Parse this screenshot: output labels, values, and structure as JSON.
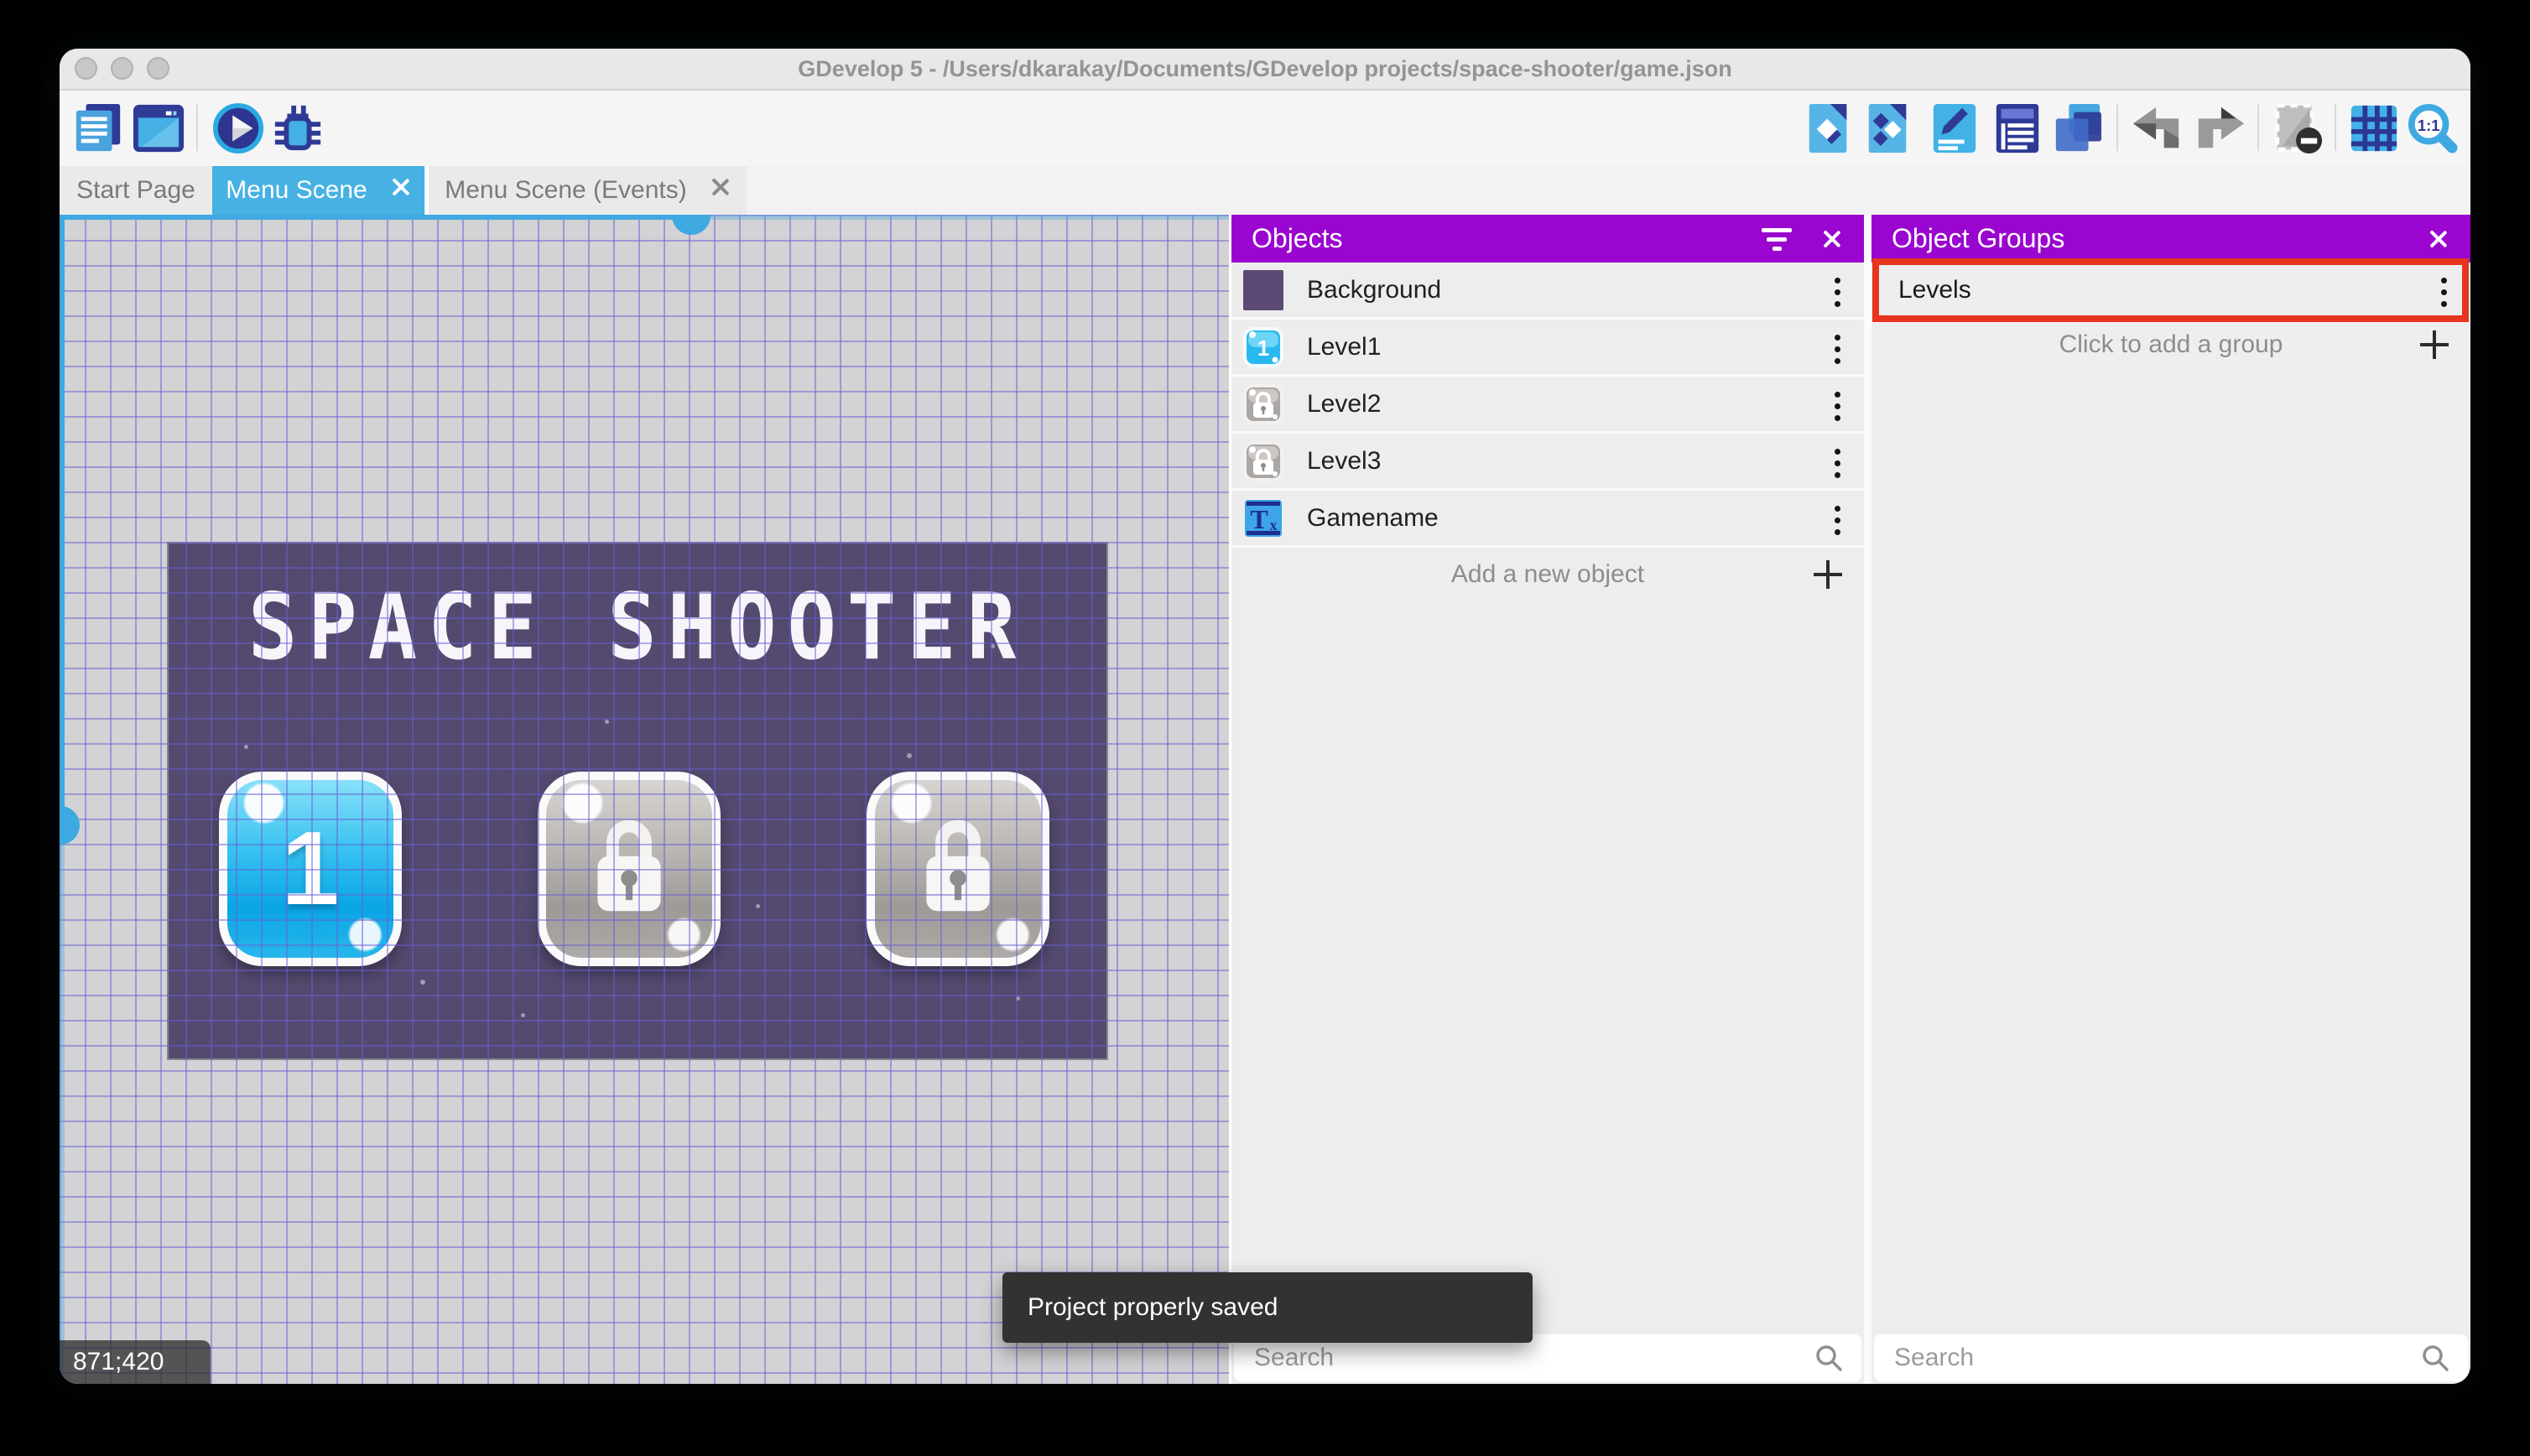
{
  "app": {
    "window_title": "GDevelop 5 - /Users/dkarakay/Documents/GDevelop projects/space-shooter/game.json"
  },
  "toolbar": {
    "left_icons": [
      "project-manager-icon",
      "scene-window-icon",
      "play-icon",
      "debug-icon"
    ],
    "right_icons": [
      "add-object-icon",
      "instances-icon",
      "edit-properties-icon",
      "instances-list-icon",
      "layers-icon",
      "undo-icon",
      "redo-icon",
      "mask-preview-icon",
      "grid-icon",
      "zoom-1-1-icon"
    ]
  },
  "tabs": [
    {
      "label": "Start Page",
      "active": false,
      "closable": false
    },
    {
      "label": "Menu Scene",
      "active": true,
      "closable": true
    },
    {
      "label": "Menu Scene (Events)",
      "active": false,
      "closable": true
    }
  ],
  "scene": {
    "title": "SPACE SHOOTER",
    "buttons": [
      {
        "label": "1",
        "state": "unlocked"
      },
      {
        "state": "locked"
      },
      {
        "state": "locked"
      }
    ],
    "cursor_coordinates": "871;420"
  },
  "objects_panel": {
    "title": "Objects",
    "items": [
      {
        "name": "Background",
        "icon": "purple-swatch"
      },
      {
        "name": "Level1",
        "icon": "level1-button"
      },
      {
        "name": "Level2",
        "icon": "locked-button"
      },
      {
        "name": "Level3",
        "icon": "locked-button"
      },
      {
        "name": "Gamename",
        "icon": "text-object"
      }
    ],
    "add_label": "Add a new object",
    "search_placeholder": "Search"
  },
  "object_groups_panel": {
    "title": "Object Groups",
    "groups": [
      {
        "name": "Levels",
        "highlighted": true
      }
    ],
    "add_label": "Click to add a group",
    "search_placeholder": "Search"
  },
  "toast": {
    "message": "Project properly saved"
  },
  "colors": {
    "tab_active": "#47b1e4",
    "panel_header_purple": "#9a06cf",
    "highlight_red": "#e8351f",
    "scene_background": "#54496e",
    "accent_blue": "#3fa9e2",
    "canvas_gray": "#d3d2d4"
  }
}
